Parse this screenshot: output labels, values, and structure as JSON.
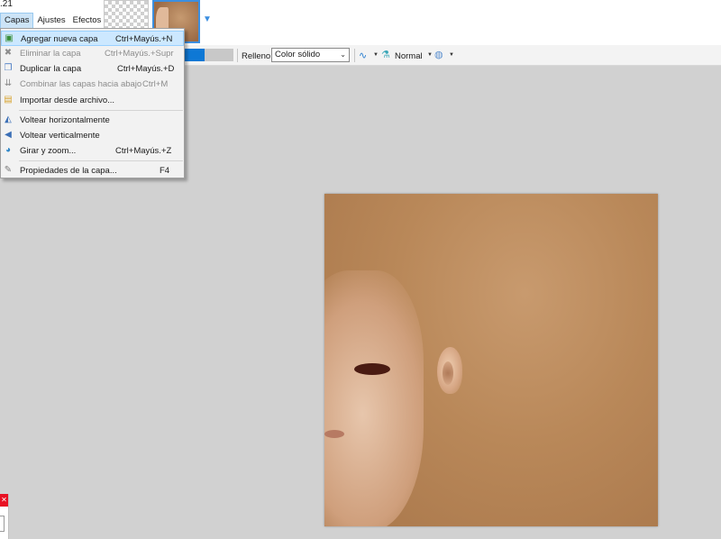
{
  "app": {
    "version_fragment": ".21"
  },
  "menubar": {
    "items": [
      "Capas",
      "Ajustes",
      "Efectos"
    ],
    "active": "Capas"
  },
  "toolbar": {
    "primary_color": "#0e78d5",
    "fill_label": "Relleno:",
    "fill_value": "Color sólido",
    "blend_mode": "Normal",
    "icons": [
      "curve-icon",
      "flask-icon",
      "globe-icon"
    ]
  },
  "layers_menu": {
    "items": [
      {
        "label": "Agregar nueva capa",
        "shortcut": "Ctrl+Mayús.+N",
        "icon": "add-layer-icon",
        "enabled": true,
        "highlighted": true
      },
      {
        "label": "Eliminar la capa",
        "shortcut": "Ctrl+Mayús.+Supr",
        "icon": "delete-layer-icon",
        "enabled": false
      },
      {
        "label": "Duplicar la capa",
        "shortcut": "Ctrl+Mayús.+D",
        "icon": "duplicate-layer-icon",
        "enabled": true
      },
      {
        "label": "Combinar las capas hacia abajo",
        "shortcut": "Ctrl+M",
        "icon": "merge-down-icon",
        "enabled": false
      },
      {
        "label": "Importar desde archivo...",
        "shortcut": "",
        "icon": "import-file-icon",
        "enabled": true
      },
      {
        "label": "Voltear horizontalmente",
        "shortcut": "",
        "icon": "flip-horizontal-icon",
        "enabled": true
      },
      {
        "label": "Voltear verticalmente",
        "shortcut": "",
        "icon": "flip-vertical-icon",
        "enabled": true
      },
      {
        "label": "Girar y zoom...",
        "shortcut": "Ctrl+Mayús.+Z",
        "icon": "rotate-zoom-icon",
        "enabled": true
      },
      {
        "label": "Propiedades de la capa...",
        "shortcut": "F4",
        "icon": "layer-properties-icon",
        "enabled": true
      }
    ]
  },
  "colors": {
    "canvas_bg": "#d1d1d1",
    "menu_highlight": "#cce8ff",
    "accent": "#3c8fe0"
  }
}
